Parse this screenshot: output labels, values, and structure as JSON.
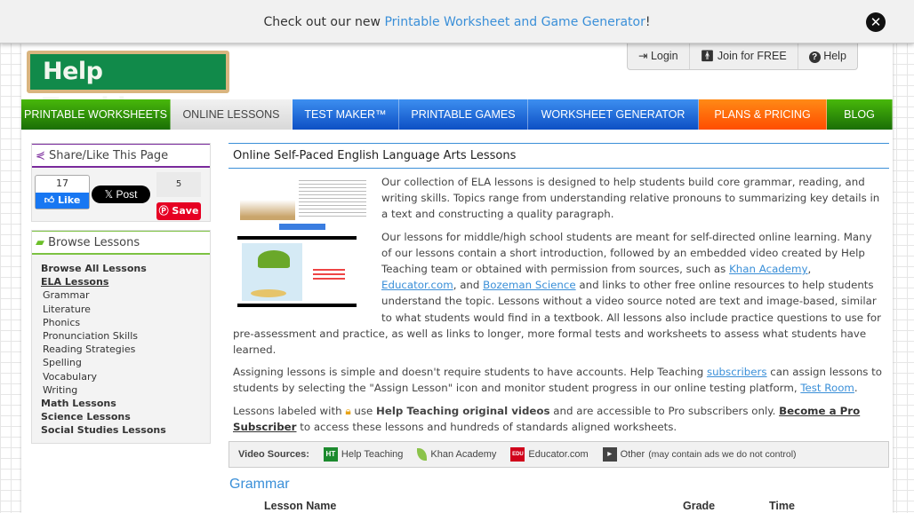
{
  "banner": {
    "text": "Check out our new ",
    "link": "Printable Worksheet and Game Generator",
    "suffix": "!"
  },
  "logo": "Help Teaching",
  "top_buttons": [
    {
      "label": "Login",
      "icon": "login-icon"
    },
    {
      "label": "Join for FREE",
      "icon": "person-icon"
    },
    {
      "label": "Help",
      "icon": "question-icon"
    }
  ],
  "nav": [
    {
      "label": "PRINTABLE WORKSHEETS",
      "color": "#2a8c0a"
    },
    {
      "label": "ONLINE LESSONS",
      "color": "#e0e0e0"
    },
    {
      "label": "TEST MAKER™",
      "color": "#1a63d8"
    },
    {
      "label": "PRINTABLE GAMES",
      "color": "#1a63d8"
    },
    {
      "label": "WORKSHEET GENERATOR",
      "color": "#1a63d8"
    },
    {
      "label": "PLANS & PRICING",
      "color": "#ff6a00"
    },
    {
      "label": "BLOG",
      "color": "#2a8c0a"
    }
  ],
  "share": {
    "title": "Share/Like This Page",
    "fb_count": "17",
    "fb_label": "Like",
    "x_label": "Post",
    "pin_count": "5",
    "pin_label": "Save"
  },
  "browse": {
    "title": "Browse Lessons",
    "items": [
      {
        "label": "Browse All Lessons",
        "type": "bold"
      },
      {
        "label": "ELA Lessons",
        "type": "current"
      },
      {
        "label": "Grammar",
        "type": "sub"
      },
      {
        "label": "Literature",
        "type": "sub"
      },
      {
        "label": "Phonics",
        "type": "sub"
      },
      {
        "label": "Pronunciation Skills",
        "type": "sub"
      },
      {
        "label": "Reading Strategies",
        "type": "sub"
      },
      {
        "label": "Spelling",
        "type": "sub"
      },
      {
        "label": "Vocabulary",
        "type": "sub"
      },
      {
        "label": "Writing",
        "type": "sub"
      },
      {
        "label": "Math Lessons",
        "type": "bold"
      },
      {
        "label": "Science Lessons",
        "type": "bold"
      },
      {
        "label": "Social Studies Lessons",
        "type": "bold"
      }
    ]
  },
  "main": {
    "title": "Online Self-Paced English Language Arts Lessons",
    "p1": "Our collection of ELA lessons is designed to help students build core grammar, reading, and writing skills. Topics range from understanding relative pronouns to summarizing key details in a text and constructing a quality paragraph.",
    "p2a": "Our lessons for middle/high school students are meant for self-directed online learning. Many of our lessons contain a short introduction, followed by an embedded video created by Help Teaching team or obtained with permission from sources, such as ",
    "khan": "Khan Academy",
    "comma": ", ",
    "educator": "Educator.com",
    "p2b": ", and ",
    "bozeman": "Bozeman Science",
    "p2c": " and links to other free online resources to help students understand the topic. Lessons without a video source noted are text and image-based, similar to what students would find in a textbook. All lessons also include practice questions to use for pre-assessment and practice, as well as links to longer, more formal tests and worksheets to assess what students have learned.",
    "p3a": "Assigning lessons is simple and doesn't require students to have accounts. Help Teaching ",
    "subscribers": "subscribers",
    "p3b": " can assign lessons to students by selecting the \"Assign Lesson\" icon and monitor student progress in our online testing platform, ",
    "testroom": "Test Room",
    "p3c": ".",
    "p4a": "Lessons labeled with ",
    "p4b": " use ",
    "p4bold": "Help Teaching original videos",
    "p4c": " and are accessible to Pro subscribers only. ",
    "p4link": "Become a Pro Subscriber",
    "p4d": " to access these lessons and hundreds of standards aligned worksheets.",
    "video_sources": {
      "label": "Video Sources:",
      "items": [
        {
          "label": "Help Teaching",
          "icon": "ht-icon",
          "badge": "HT",
          "color": "#1c8a2e"
        },
        {
          "label": "Khan Academy",
          "icon": "leaf-icon",
          "color": "#8bc34a"
        },
        {
          "label": "Educator.com",
          "icon": "edu-icon",
          "badge": "EDU",
          "color": "#d0021b"
        },
        {
          "label": "Other",
          "note": " (may contain ads we do not control)",
          "icon": "youtube-icon",
          "color": "#444"
        }
      ]
    },
    "section": "Grammar",
    "table_headers": [
      "Lesson Name",
      "Grade",
      "Time"
    ]
  }
}
